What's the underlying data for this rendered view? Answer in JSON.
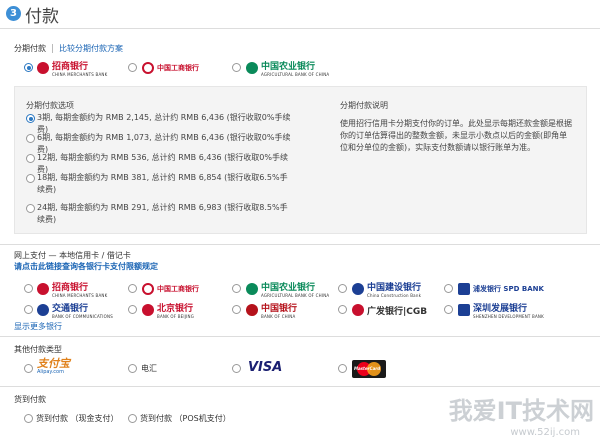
{
  "step": {
    "number": "3",
    "title": "付款"
  },
  "installment": {
    "section_label": "分期付款",
    "compare_link": "比较分期付款方案",
    "banks": [
      {
        "name_cn": "招商银行",
        "name_en": "CHINA MERCHANTS BANK",
        "selected": true,
        "color": "#c8102e"
      },
      {
        "name_cn": "中国工商银行",
        "name_en": "",
        "selected": false,
        "color": "#c8102e"
      },
      {
        "name_cn": "中国农业银行",
        "name_en": "AGRICULTURAL BANK OF CHINA",
        "selected": false,
        "color": "#0a8a5a"
      }
    ],
    "options_title": "分期付款选项",
    "options": [
      {
        "text": "3期, 每期金额约为 RMB 2,145, 总计约 RMB 6,436 (银行收取0%手续费)",
        "selected": true
      },
      {
        "text": "6期, 每期金额约为 RMB 1,073, 总计约 RMB 6,436 (银行收取0%手续费)",
        "selected": false
      },
      {
        "text": "12期, 每期金额约为 RMB 536, 总计约 RMB 6,436 (银行收取0%手续费)",
        "selected": false
      },
      {
        "text": "18期, 每期金额约为 RMB 381, 总计约 RMB 6,854 (银行收取6.5%手续费)",
        "selected": false
      },
      {
        "text": "24期, 每期金额约为 RMB 291, 总计约 RMB 6,983 (银行收取8.5%手续费)",
        "selected": false
      }
    ],
    "desc_title": "分期付款说明",
    "desc_text": "使用招行信用卡分期支付你的订单。此处显示每期还款金额是根据你的订单估算得出的整数金额，未显示小数点以后的金额(即角单位和分单位的金额)，实际支付数额请以银行账单为准。"
  },
  "online": {
    "title": "网上支付 — 本地信用卡 / 借记卡",
    "notice": "请点击此链接查询各银行卡支付限额规定",
    "banks": [
      {
        "name_cn": "招商银行",
        "name_en": "CHINA MERCHANTS BANK",
        "color": "#c8102e"
      },
      {
        "name_cn": "中国工商银行",
        "name_en": "",
        "color": "#c8102e"
      },
      {
        "name_cn": "中国农业银行",
        "name_en": "AGRICULTURAL BANK OF CHINA",
        "color": "#0a8a5a"
      },
      {
        "name_cn": "中国建设银行",
        "name_en": "China Construction Bank",
        "color": "#1c3f94"
      },
      {
        "name_cn": "浦发银行 SPD BANK",
        "name_en": "",
        "color": "#1c3f94"
      },
      {
        "name_cn": "交通银行",
        "name_en": "BANK OF COMMUNICATIONS",
        "color": "#1c3f94"
      },
      {
        "name_cn": "北京银行",
        "name_en": "BANK OF BEIJING",
        "color": "#c8102e"
      },
      {
        "name_cn": "中国银行",
        "name_en": "BANK OF CHINA",
        "color": "#b5121b"
      },
      {
        "name_cn": "广发银行|CGB",
        "name_en": "",
        "color": "#c8102e"
      },
      {
        "name_cn": "深圳发展银行",
        "name_en": "SHENZHEN DEVELOPMENT BANK",
        "color": "#1c3f94"
      }
    ],
    "more_link": "显示更多银行"
  },
  "other": {
    "title": "其他付款类型",
    "options": [
      {
        "label": "支付宝",
        "sub": "Alipay.com"
      },
      {
        "label": "电汇",
        "sub": ""
      },
      {
        "label": "VISA",
        "sub": ""
      },
      {
        "label": "MasterCard",
        "sub": ""
      }
    ]
  },
  "cod": {
    "title": "货到付款",
    "options": [
      {
        "label": "货到付款 （现金支付）"
      },
      {
        "label": "货到付款 （POS机支付）"
      }
    ]
  },
  "watermark": {
    "main": "我爱IT技术网",
    "sub": "www.52ij.com"
  }
}
